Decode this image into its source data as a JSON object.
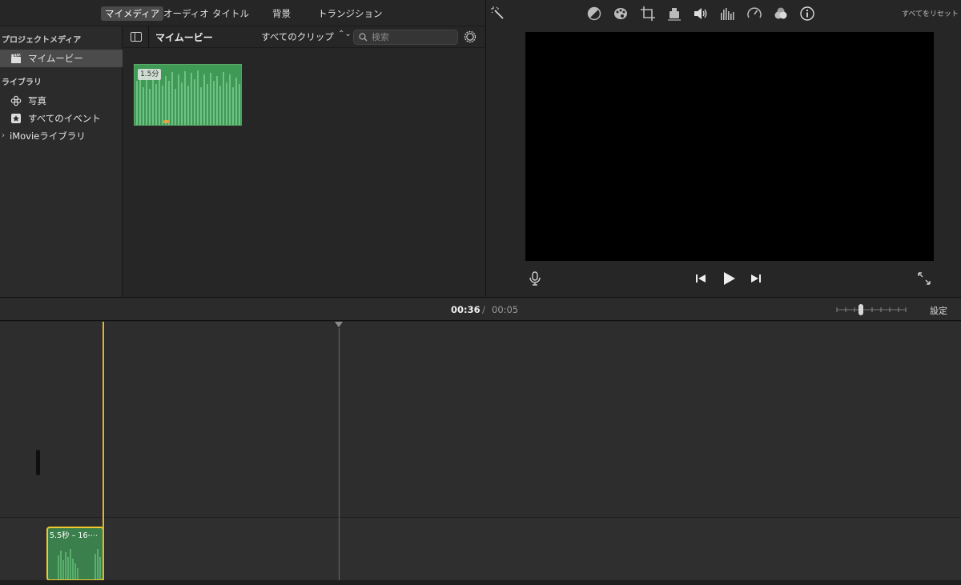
{
  "tabs": [
    {
      "label": "マイメディア",
      "active": true
    },
    {
      "label": "オーディオ"
    },
    {
      "label": "タイトル"
    },
    {
      "label": "背景"
    },
    {
      "label": "トランジション"
    }
  ],
  "sidebar": {
    "project_heading": "プロジェクトメディア",
    "project_item": {
      "label": "マイムービー",
      "icon": "clapperboard-icon"
    },
    "library_heading": "ライブラリ",
    "items": [
      {
        "label": "写真",
        "icon": "photos-icon"
      },
      {
        "label": "すべてのイベント",
        "icon": "star-icon"
      }
    ],
    "library_item": {
      "label": "iMovieライブラリ",
      "icon": "chevron-right-icon"
    }
  },
  "content": {
    "title": "マイムービー",
    "filter_label": "すべてのクリップ",
    "search_placeholder": "検索",
    "thumbnail": {
      "duration": "1.5分",
      "color": "#3f9a55"
    }
  },
  "viewer": {
    "tools": [
      "magic-wand-icon",
      "color-balance-icon",
      "color-correction-icon",
      "crop-icon",
      "stabilization-icon",
      "volume-icon",
      "equalizer-icon",
      "speed-icon",
      "noise-reduction-icon",
      "info-icon"
    ],
    "reset_all": "すべてをリセット"
  },
  "timebar": {
    "current": "00:36",
    "separator": "/",
    "total": "00:05",
    "settings": "設定"
  },
  "timeline": {
    "audio_clip_label": "5.5秒 – 16-⋯",
    "playhead_color": "#e3b32a"
  }
}
